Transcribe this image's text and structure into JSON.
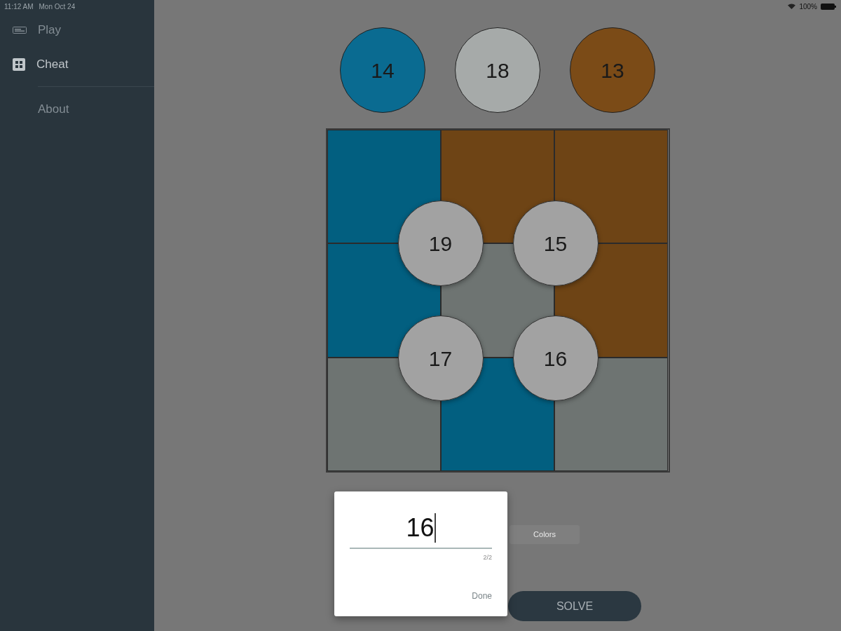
{
  "status_bar": {
    "time": "11:12 AM",
    "date": "Mon Oct 24",
    "battery": "100%"
  },
  "sidebar": {
    "main_items": [
      {
        "label": "Play",
        "kind": "bars",
        "selected": false
      },
      {
        "label": "Cheat",
        "kind": "grid",
        "selected": true
      }
    ],
    "footer_items": [
      {
        "label": "About",
        "kind": "plain",
        "selected": false
      }
    ]
  },
  "targets": [
    {
      "value": "14",
      "color": "#0a6b91"
    },
    {
      "value": "18",
      "color": "#a6aaa9"
    },
    {
      "value": "13",
      "color": "#7b4b17"
    }
  ],
  "board": {
    "cells": [
      {
        "color": "#025f80"
      },
      {
        "color": "#6e4415"
      },
      {
        "color": "#6e4415"
      },
      {
        "color": "#025f80"
      },
      {
        "color": "#6e7472"
      },
      {
        "color": "#6e4415"
      },
      {
        "color": "#6e7472"
      },
      {
        "color": "#025f80"
      },
      {
        "color": "#6e7472"
      }
    ],
    "sums": [
      "19",
      "15",
      "17",
      "16"
    ]
  },
  "controls": {
    "colors_button": "Colors",
    "solve_button": "SOLVE"
  },
  "dialog": {
    "value": "16",
    "focused": true,
    "counter": "2/2",
    "done_button": "Done"
  }
}
